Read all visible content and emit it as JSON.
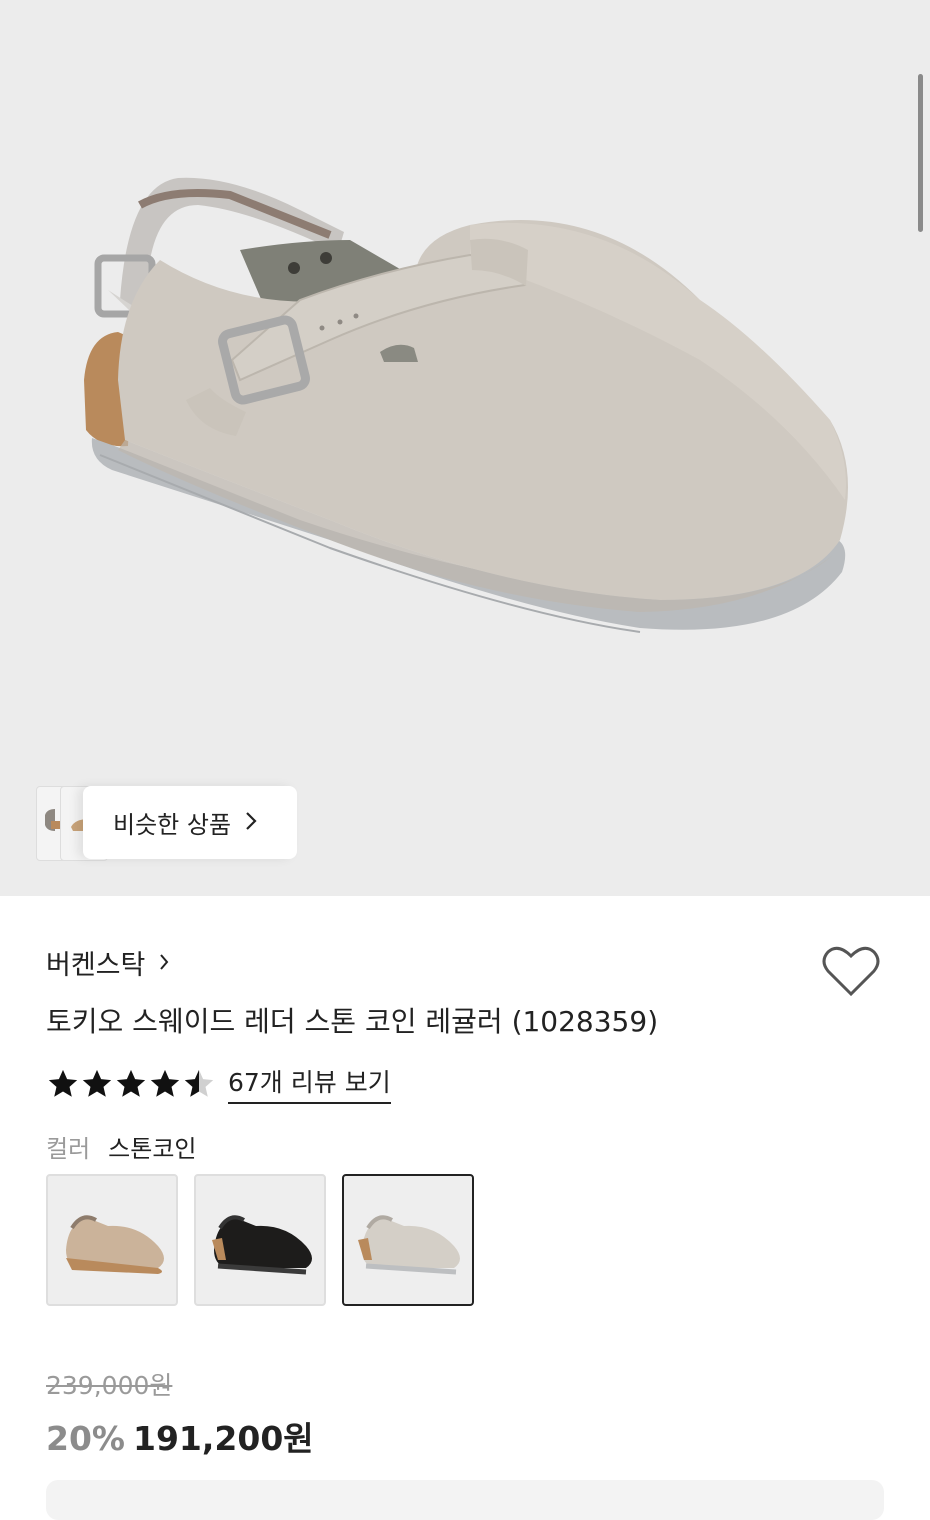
{
  "similar": {
    "label": "비슷한 상품"
  },
  "product": {
    "brand": "버켄스탁",
    "title": "토키오 스웨이드 레더 스톤 코인 레귤러 (1028359)",
    "rating": 4.5,
    "review_link": "67개 리뷰 보기"
  },
  "color": {
    "label": "컬러",
    "value": "스톤코인",
    "options": [
      "taupe",
      "black",
      "stone-coin"
    ],
    "selected": 2
  },
  "price": {
    "original": "239,000원",
    "discount": "20%",
    "sale": "191,200원"
  },
  "colors": {
    "hero_bg": "#ececec",
    "suede_stone": "#cfc9c1",
    "cork": "#b98a5c",
    "sole": "#b9bcbf",
    "text": "#222222",
    "muted": "#9a9a9a"
  }
}
